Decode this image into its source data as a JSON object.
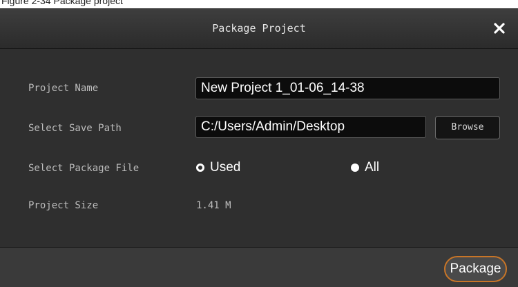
{
  "caption": "Figure 2-34 Package project",
  "dialog": {
    "title": "Package Project",
    "close_icon": "close-icon"
  },
  "form": {
    "project_name_label": "Project Name",
    "project_name_value": "New Project 1_01-06_14-38",
    "save_path_label": "Select Save Path",
    "save_path_value": "C:/Users/Admin/Desktop",
    "browse_label": "Browse",
    "package_file_label": "Select Package File",
    "package_file_options": [
      {
        "label": "Used",
        "selected": false
      },
      {
        "label": "All",
        "selected": true
      }
    ],
    "project_size_label": "Project Size",
    "project_size_value": "1.41 M"
  },
  "footer": {
    "package_label": "Package"
  },
  "colors": {
    "background": "#2f2f2f",
    "field_background": "#0c0c0c",
    "accent": "#c87527"
  }
}
